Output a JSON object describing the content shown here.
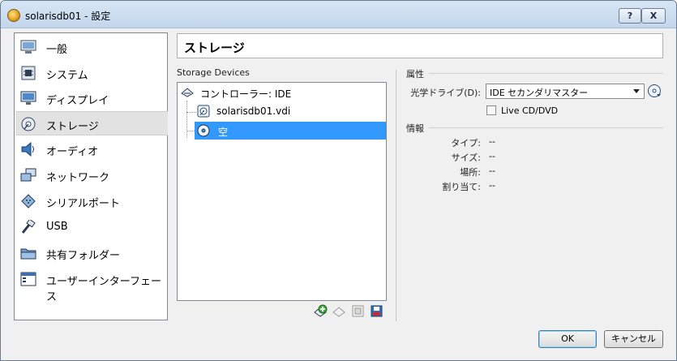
{
  "window": {
    "title": "solarisdb01 - 設定",
    "help_label": "?",
    "close_label": "X"
  },
  "sidebar": {
    "items": [
      {
        "label": "一般",
        "icon": "general-icon"
      },
      {
        "label": "システム",
        "icon": "system-icon"
      },
      {
        "label": "ディスプレイ",
        "icon": "display-icon"
      },
      {
        "label": "ストレージ",
        "icon": "storage-icon",
        "selected": true
      },
      {
        "label": "オーディオ",
        "icon": "audio-icon"
      },
      {
        "label": "ネットワーク",
        "icon": "network-icon"
      },
      {
        "label": "シリアルポート",
        "icon": "serial-port-icon"
      },
      {
        "label": "USB",
        "icon": "usb-icon"
      },
      {
        "label": "共有フォルダー",
        "icon": "shared-folder-icon"
      },
      {
        "label": "ユーザーインターフェース",
        "icon": "user-interface-icon"
      }
    ]
  },
  "page": {
    "title": "ストレージ"
  },
  "storage": {
    "devices_label": "Storage Devices",
    "controller": "コントローラー: IDE",
    "disk": "solarisdb01.vdi",
    "optical": "空"
  },
  "attributes": {
    "section_title": "属性",
    "optical_drive_label": "光学ドライブ(D):",
    "optical_drive_value": "IDE セカンダリマスター",
    "live_cd_label": "Live CD/DVD",
    "live_cd_checked": false
  },
  "info": {
    "section_title": "情報",
    "rows": [
      {
        "label": "タイプ:",
        "value": "--"
      },
      {
        "label": "サイズ:",
        "value": "--"
      },
      {
        "label": "場所:",
        "value": "--"
      },
      {
        "label": "割り当て:",
        "value": "--"
      }
    ]
  },
  "buttons": {
    "ok": "OK",
    "cancel": "キャンセル"
  },
  "colors": {
    "selection": "#3399ff",
    "titlebar": "#c9dcf0"
  }
}
